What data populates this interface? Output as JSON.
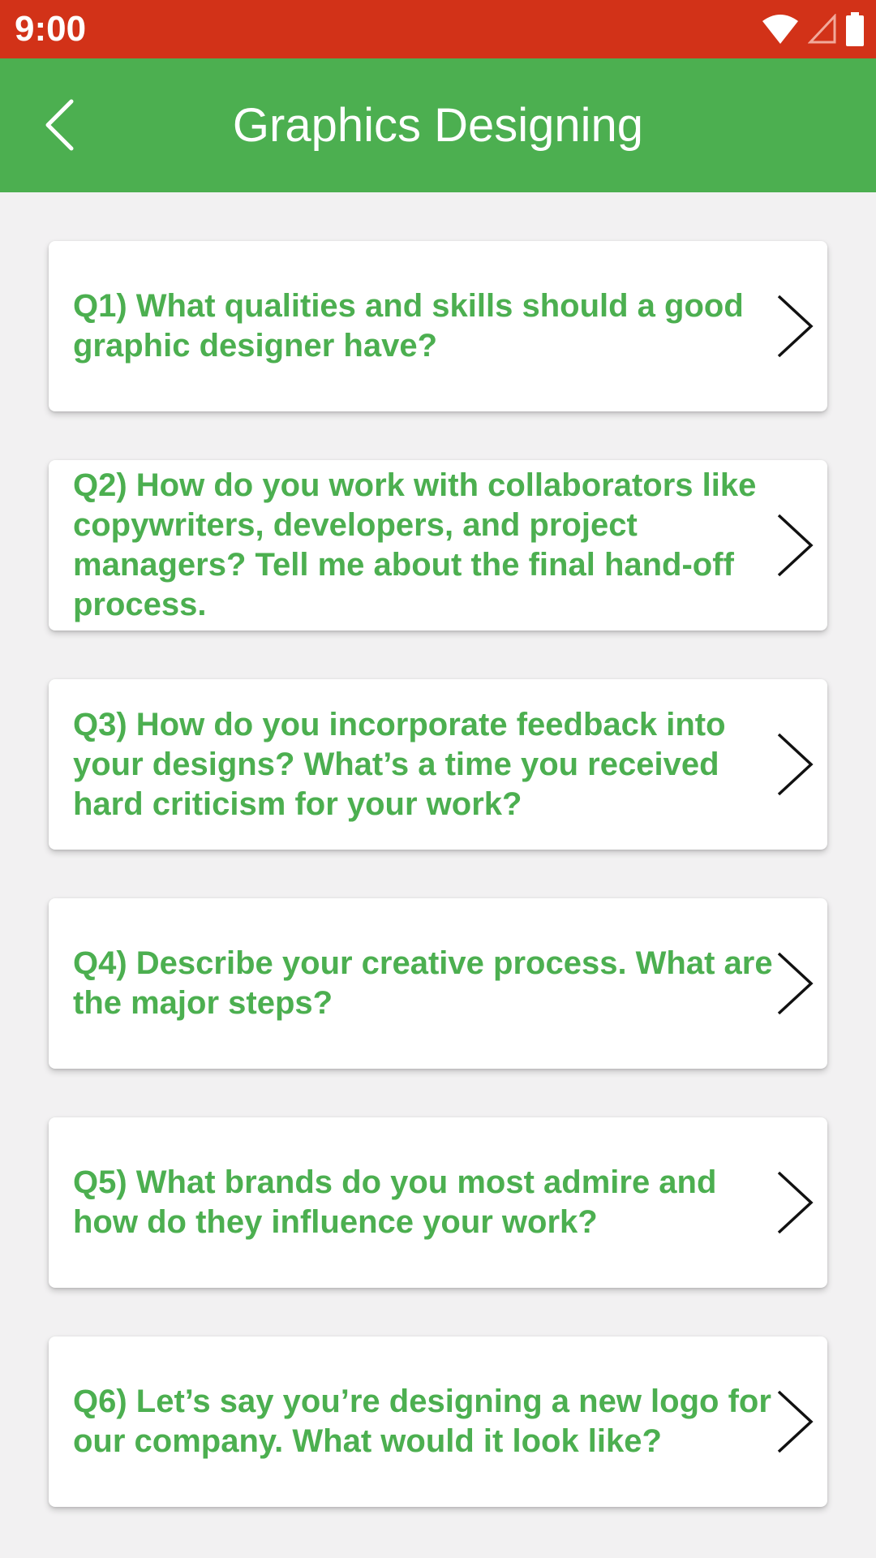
{
  "status_bar": {
    "time": "9:00",
    "icons": [
      "wifi-icon",
      "cell-signal-icon",
      "battery-icon"
    ],
    "color": "#d23218"
  },
  "app_bar": {
    "title": "Graphics Designing",
    "back_icon": "chevron-left-icon",
    "color": "#4caf50"
  },
  "questions": [
    {
      "text": "Q1) What qualities and skills should a good graphic designer have?"
    },
    {
      "text": "Q2) How do you work with collaborators like copywriters, developers, and project managers? Tell me about the final hand-off process."
    },
    {
      "text": "Q3) How do you incorporate feedback into your designs? What’s a time you received hard criticism for your work?"
    },
    {
      "text": "Q4) Describe your creative process. What are the major steps?"
    },
    {
      "text": "Q5) What brands do you most admire and how do they influence your work?"
    },
    {
      "text": "Q6) Let’s say you’re designing a new logo for our company. What would it look like?"
    }
  ],
  "colors": {
    "accent": "#4caf50",
    "background": "#f2f1f2"
  }
}
